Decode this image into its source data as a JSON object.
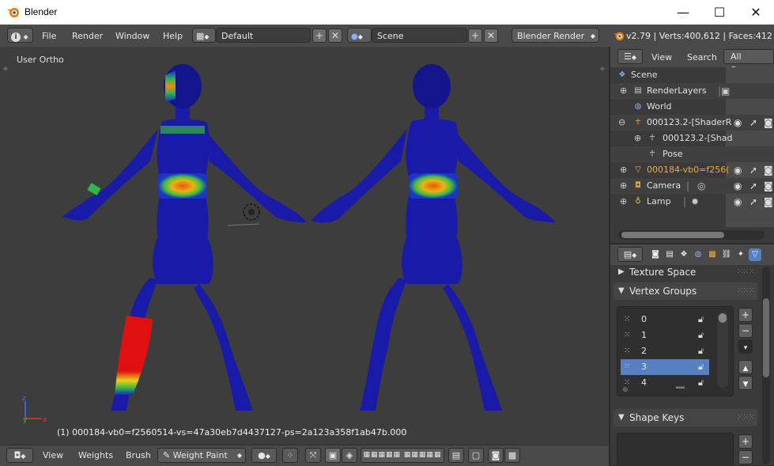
{
  "window": {
    "title": "Blender",
    "minimize": "—",
    "maximize": "☐",
    "close": "✕"
  },
  "infobar": {
    "menus": [
      "File",
      "Render",
      "Window",
      "Help"
    ],
    "layout": "Default",
    "scene": "Scene",
    "engine": "Blender Render",
    "stats": "v2.79 | Verts:400,612 | Faces:412"
  },
  "viewport": {
    "view_label": "User Ortho",
    "status_line": "(1) 000184-vb0=f2560514-vs=47a30eb7d4437127-ps=2a123a358f1ab47b.000"
  },
  "toolbar": {
    "menus": [
      "View",
      "Weights",
      "Brush"
    ],
    "mode": "Weight Paint"
  },
  "outliner": {
    "header_menus": [
      "View",
      "Search"
    ],
    "scope": "All Scenes",
    "rows": [
      {
        "label": "Scene"
      },
      {
        "label": "RenderLayers"
      },
      {
        "label": "World"
      },
      {
        "label": "000123.2-[ShaderR"
      },
      {
        "label": "000123.2-[Shad"
      },
      {
        "label": "Pose"
      },
      {
        "label": "000184-vb0=f256("
      },
      {
        "label": "Camera"
      },
      {
        "label": "Lamp"
      }
    ]
  },
  "properties": {
    "texture_space": "Texture Space",
    "vertex_groups": "Vertex Groups",
    "groups": [
      "0",
      "1",
      "2",
      "3",
      "4"
    ],
    "selected_group": "3",
    "shape_keys": "Shape Keys"
  },
  "colors": {
    "selection": "#5680c2",
    "mesh_blue": "#1a1aa8",
    "active_object": "#f2a83a"
  }
}
